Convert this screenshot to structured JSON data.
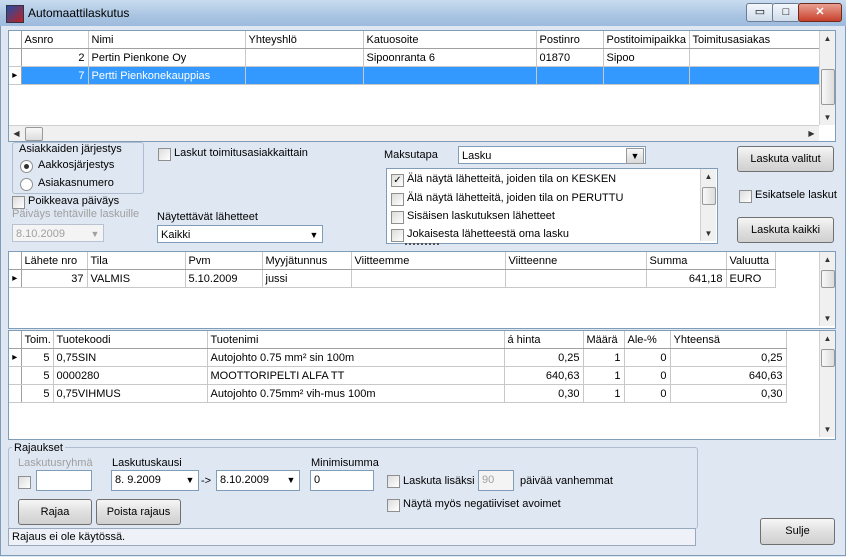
{
  "window": {
    "title": "Automaattilaskutus",
    "buttons": {
      "minimize": "▭",
      "maximize": "□",
      "close": "✕"
    }
  },
  "customers": {
    "columns": [
      "Asnro",
      "Nimi",
      "Yhteyshlö",
      "Katuosoite",
      "Postinro",
      "Postitoimipaikka",
      "Toimitusasiakas"
    ],
    "rows": [
      {
        "indicator": "",
        "asnro": "2",
        "nimi": "Pertin Pienkone Oy",
        "yhteys": "",
        "katu": "Sipoonranta 6",
        "postinro": "01870",
        "paikka": "Sipoo",
        "toimitus": ""
      },
      {
        "indicator": "▸",
        "asnro": "7",
        "nimi": "Pertti Pienkonekauppias",
        "yhteys": "",
        "katu": "",
        "postinro": "",
        "paikka": "",
        "toimitus": ""
      }
    ]
  },
  "options": {
    "sort_title": "Asiakkaiden järjestys",
    "sort_alpha": "Aakkosjärjestys",
    "sort_number": "Asiakasnumero",
    "invoices_per_delivery": "Laskut toimitusasiakkaittain",
    "alt_date": "Poikkeava päiväys",
    "alt_date_label": "Päiväys tehtäville laskuille",
    "alt_date_value": "8.10.2009",
    "shown_deliveries_label": "Näytettävät lähetteet",
    "shown_deliveries_value": "Kaikki",
    "payment_label": "Maksutapa",
    "payment_value": "Lasku",
    "filters": [
      {
        "label": "Älä näytä lähetteitä, joiden tila on KESKEN",
        "checked": "✓"
      },
      {
        "label": "Älä näytä lähetteitä, joiden tila on PERUTTU",
        "checked": ""
      },
      {
        "label": "Sisäisen laskutuksen lähetteet",
        "checked": ""
      },
      {
        "label": "Jokaisesta lähetteestä oma lasku",
        "checked": ""
      }
    ],
    "invoice_selected": "Laskuta valitut",
    "preview": "Esikatsele laskut",
    "invoice_all": "Laskuta kaikki"
  },
  "deliveries": {
    "columns": [
      "Lähete nro",
      "Tila",
      "Pvm",
      "Myyjätunnus",
      "Viitteemme",
      "Viitteenne",
      "Summa",
      "Valuutta"
    ],
    "rows": [
      {
        "indicator": "▸",
        "nro": "37",
        "tila": "VALMIS",
        "pvm": "5.10.2009",
        "myyja": "jussi",
        "viitteemme": "",
        "viitteenne": "",
        "summa": "641,18",
        "valuutta": "EURO"
      }
    ]
  },
  "products": {
    "columns": [
      "Toim.",
      "Tuotekoodi",
      "Tuotenimi",
      "á hinta",
      "Määrä",
      "Ale-%",
      "Yhteensä"
    ],
    "rows": [
      {
        "indicator": "▸",
        "toim": "5",
        "koodi": "0,75SIN",
        "nimi": "Autojohto 0.75 mm² sin    100m",
        "hinta": "0,25",
        "maara": "1",
        "ale": "0",
        "yht": "0,25"
      },
      {
        "indicator": "",
        "toim": "5",
        "koodi": "0000280",
        "nimi": "MOOTTORIPELTI ALFA TT",
        "hinta": "640,63",
        "maara": "1",
        "ale": "0",
        "yht": "640,63"
      },
      {
        "indicator": "",
        "toim": "5",
        "koodi": "0,75VIHMUS",
        "nimi": "Autojohto 0.75mm² vih-mus 100m",
        "hinta": "0,30",
        "maara": "1",
        "ale": "0",
        "yht": "0,30"
      }
    ]
  },
  "limits": {
    "title": "Rajaukset",
    "group_label": "Laskutusryhmä",
    "period_label": "Laskutuskausi",
    "period_from": "8.  9.2009",
    "period_arrow": "->",
    "period_to": "8.10.2009",
    "min_sum_label": "Minimisumma",
    "min_sum_value": "0",
    "older_label": "Laskuta lisäksi",
    "older_days": "90",
    "older_suffix": "päivää vanhemmat",
    "negative_label": "Näytä myös negatiiviset avoimet",
    "apply": "Rajaa",
    "remove": "Poista rajaus"
  },
  "status": "Rajaus ei ole käytössä.",
  "close_button": "Sulje"
}
